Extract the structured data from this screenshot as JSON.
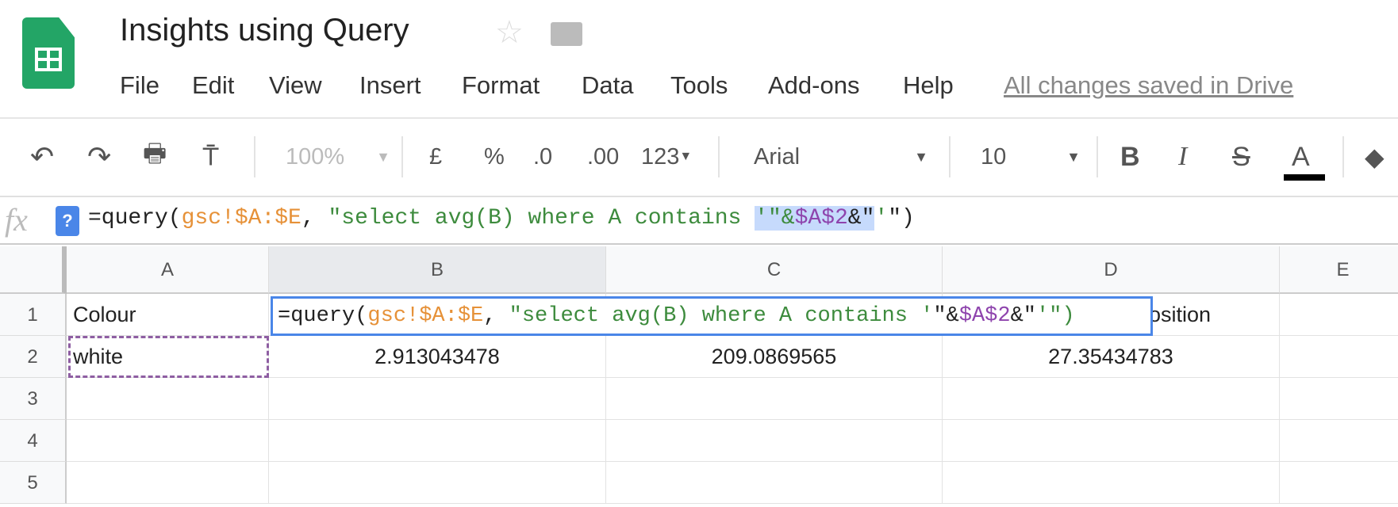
{
  "app": {
    "title": "Insights using Query",
    "saved_status": "All changes saved in Drive"
  },
  "menu": [
    "File",
    "Edit",
    "View",
    "Insert",
    "Format",
    "Data",
    "Tools",
    "Add-ons",
    "Help"
  ],
  "toolbar": {
    "zoom": "100%",
    "currency": "£",
    "percent": "%",
    "dec_decrease": ".0",
    "dec_increase": ".00",
    "more_formats": "123",
    "font": "Arial",
    "font_size": "10",
    "bold": "B",
    "italic": "I",
    "strike": "S",
    "text_color": "A"
  },
  "formula_bar": {
    "fx": "fx",
    "help": "?",
    "parts": [
      "=query(",
      "gsc!$A:$E",
      ", ",
      "\"select avg(B) where A contains ",
      "'\"&",
      "$A$2",
      "&\"",
      "'",
      "\")"
    ]
  },
  "columns": [
    "A",
    "B",
    "C",
    "D",
    "E"
  ],
  "rows": [
    "1",
    "2",
    "3",
    "4",
    "5"
  ],
  "cells": {
    "A1": "Colour",
    "D1_visible": "osition",
    "A2": "white",
    "B2": "2.913043478",
    "C2": "209.0869565",
    "D2": "27.35434783"
  },
  "cell_editor": {
    "parts": [
      "=query(",
      "gsc!$A:$E",
      ", ",
      "\"select avg(B) where A contains '",
      "\"&",
      "$A$2",
      "&\"",
      "'\")"
    ]
  }
}
